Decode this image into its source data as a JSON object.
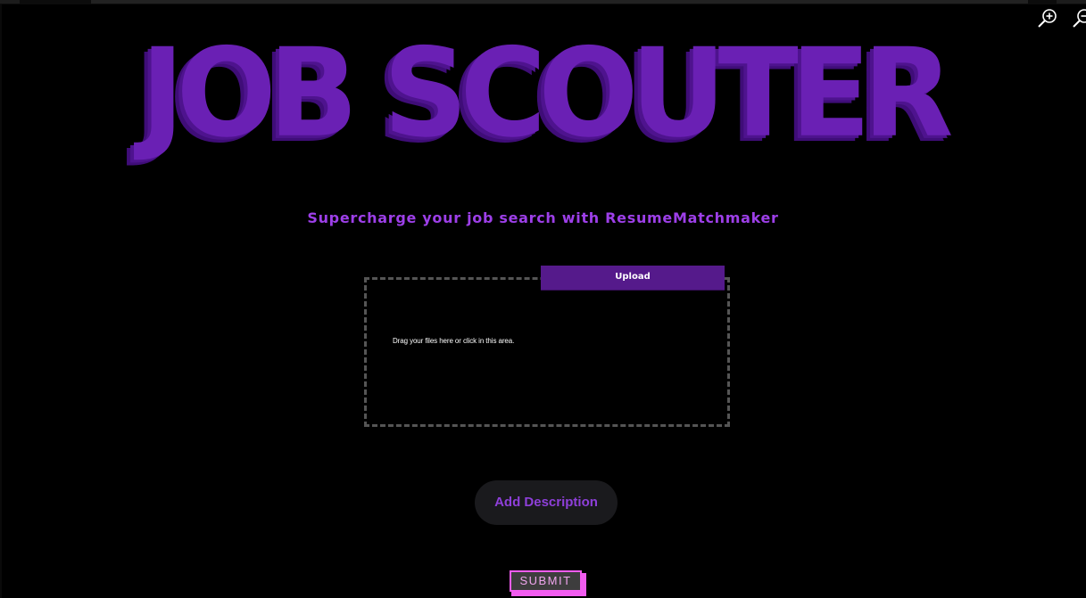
{
  "header": {
    "title": "JOB SCOUTER",
    "subtitle": "Supercharge your job search with ResumeMatchmaker"
  },
  "toolbar": {
    "zoom_in_icon": "zoom-in-icon",
    "zoom_out_icon": "zoom-out-icon"
  },
  "upload": {
    "button_label": "Upload",
    "dropzone_text": "Drag your files here or click in this area."
  },
  "actions": {
    "add_description_label": "Add Description",
    "submit_label": "SUBMIT"
  },
  "colors": {
    "title": "#6a20b4",
    "subtitle": "#9d3fe8",
    "upload_button": "#551a8b",
    "add_description_text": "#8e3fd9",
    "submit_border": "#f25cf0",
    "background": "#000000"
  }
}
